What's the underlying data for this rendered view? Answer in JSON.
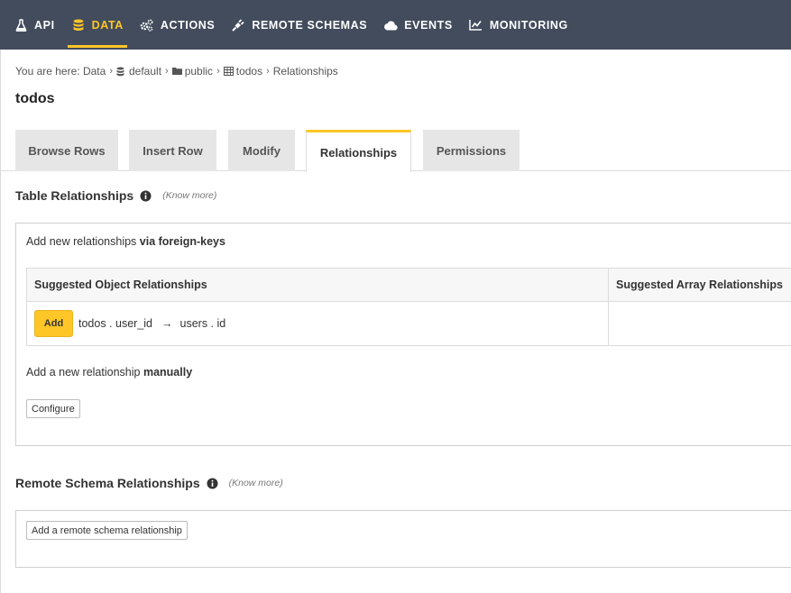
{
  "nav": {
    "items": [
      {
        "label": "API",
        "icon": "flask-icon"
      },
      {
        "label": "DATA",
        "icon": "database-icon"
      },
      {
        "label": "ACTIONS",
        "icon": "cogs-icon"
      },
      {
        "label": "REMOTE SCHEMAS",
        "icon": "plug-icon"
      },
      {
        "label": "EVENTS",
        "icon": "cloud-icon"
      },
      {
        "label": "MONITORING",
        "icon": "line-chart-icon"
      }
    ],
    "active": "DATA",
    "accent_color": "#ffc627",
    "background_color": "#424c5c"
  },
  "breadcrumb": {
    "prefix": "You are here:",
    "data": "Data",
    "source": "default",
    "schema": "public",
    "table": "todos",
    "current": "Relationships"
  },
  "page": {
    "title": "todos"
  },
  "tabs": [
    {
      "label": "Browse Rows"
    },
    {
      "label": "Insert Row"
    },
    {
      "label": "Modify"
    },
    {
      "label": "Relationships"
    },
    {
      "label": "Permissions"
    }
  ],
  "table_relationships": {
    "title": "Table Relationships",
    "know_more": "(Know more)",
    "foreign_keys_text": "Add new relationships",
    "foreign_keys_bold": "via foreign-keys",
    "columns": {
      "object": "Suggested Object Relationships",
      "array": "Suggested Array Relationships"
    },
    "suggestion": {
      "add_label": "Add",
      "from": "todos . user_id",
      "arrow": "→",
      "to": "users . id"
    },
    "manual_text": "Add a new relationship",
    "manual_bold": "manually",
    "configure_label": "Configure"
  },
  "remote_schema_relationships": {
    "title": "Remote Schema Relationships",
    "know_more": "(Know more)",
    "add_label": "Add a remote schema relationship"
  }
}
